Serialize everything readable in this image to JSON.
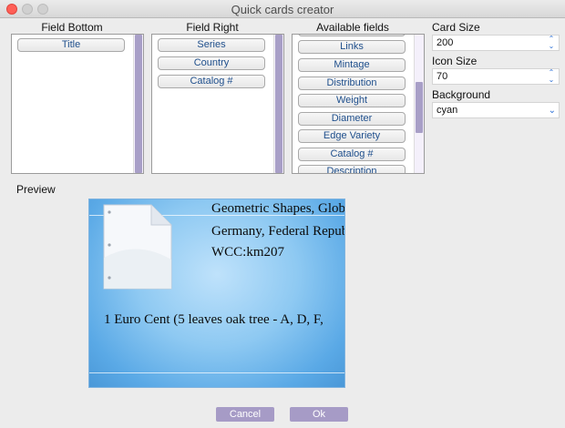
{
  "window": {
    "title": "Quick cards creator"
  },
  "columns": {
    "field_bottom": {
      "label": "Field Bottom",
      "items": [
        "Title"
      ]
    },
    "field_right": {
      "label": "Field Right",
      "items": [
        "Series",
        "Country",
        "Catalog #"
      ]
    },
    "available": {
      "label": "Available fields",
      "items": [
        "Links",
        "Mintage",
        "Distribution",
        "Weight",
        "Diameter",
        "Edge Variety",
        "Catalog #",
        "Description"
      ]
    }
  },
  "settings": {
    "card_size": {
      "label": "Card Size",
      "value": "200"
    },
    "icon_size": {
      "label": "Icon Size",
      "value": "70"
    },
    "background": {
      "label": "Background",
      "value": "cyan"
    }
  },
  "preview": {
    "label": "Preview",
    "lines_right": [
      "Geometric Shapes, Globe",
      "Germany, Federal Repub",
      "WCC:km207"
    ],
    "line_bottom": "1 Euro Cent (5 leaves oak tree - A, D, F,"
  },
  "buttons": {
    "cancel": "Cancel",
    "ok": "Ok"
  },
  "colors": {
    "accent": "#a69bc6",
    "link_text": "#1f4f8c",
    "card_bg": "#8ec9f2"
  },
  "icons": {
    "stepper": "stepper-icon",
    "dropdown": "chevron-down-icon",
    "document": "document-icon"
  }
}
